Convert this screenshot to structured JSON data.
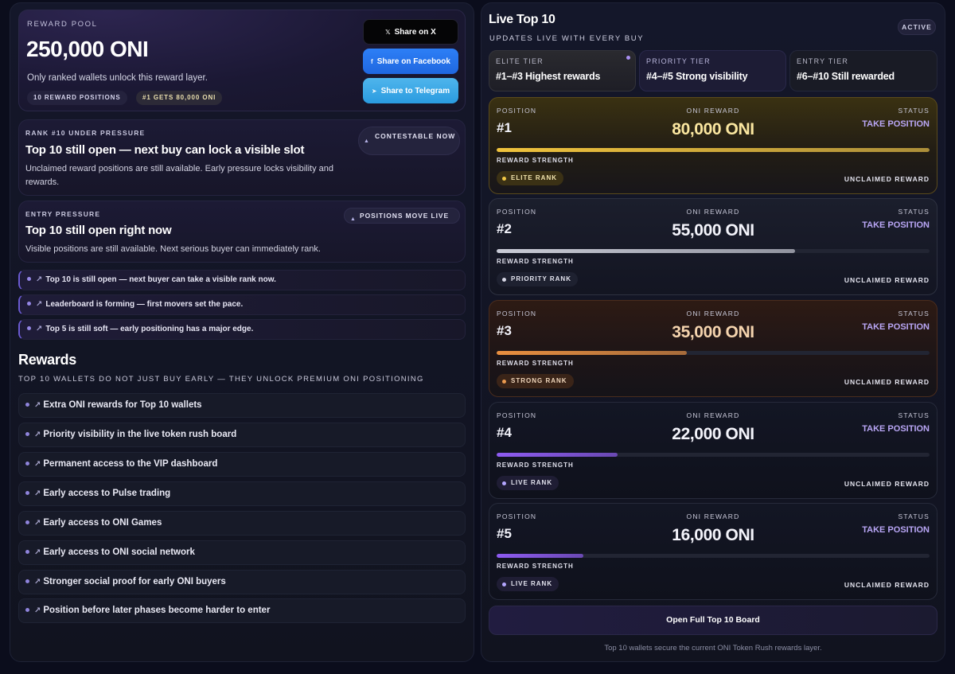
{
  "reward_pool": {
    "kicker": "REWARD POOL",
    "amount": "250,000 ONI",
    "note": "Only ranked wallets unlock this reward layer.",
    "pills": [
      "10 REWARD POSITIONS",
      "#1 GETS 80,000 ONI"
    ]
  },
  "share": {
    "x_label": "Share on X",
    "x_icon": "𝕏",
    "facebook_label": "Share on Facebook",
    "facebook_icon": "f",
    "telegram_label": "Share to Telegram",
    "telegram_icon": "➤"
  },
  "rank_pressure": {
    "kicker": "RANK #10 UNDER PRESSURE",
    "title": "Top 10 still open — next buy can lock a visible slot",
    "body": "Unclaimed reward positions are still available. Early pressure locks visibility and rewards.",
    "badge": "CONTESTABLE NOW"
  },
  "entry_pressure": {
    "kicker": "ENTRY PRESSURE",
    "title": "Top 10 still open right now",
    "body": "Visible positions are still available. Next serious buyer can immediately rank.",
    "badge": "POSITIONS MOVE LIVE"
  },
  "tickers": [
    "Top 10 is still open — next buyer can take a visible rank now.",
    "Leaderboard is forming — first movers set the pace.",
    "Top 5 is still soft — early positioning has a major edge."
  ],
  "rewards": {
    "title": "Rewards",
    "subtitle": "TOP 10 WALLETS DO NOT JUST BUY EARLY — THEY UNLOCK PREMIUM ONI POSITIONING",
    "items": [
      "Extra ONI rewards for Top 10 wallets",
      "Priority visibility in the live token rush board",
      "Permanent access to the VIP dashboard",
      "Early access to Pulse trading",
      "Early access to ONI Games",
      "Early access to ONI social network",
      "Stronger social proof for early ONI buyers",
      "Position before later phases become harder to enter"
    ]
  },
  "live": {
    "title": "Live Top 10",
    "subtitle": "UPDATES LIVE WITH EVERY BUY",
    "status": "ACTIVE"
  },
  "tiers": [
    {
      "kicker": "ELITE TIER",
      "value": "#1–#3 Highest rewards"
    },
    {
      "kicker": "PRIORITY TIER",
      "value": "#4–#5 Strong visibility"
    },
    {
      "kicker": "ENTRY TIER",
      "value": "#6–#10 Still rewarded"
    }
  ],
  "labels": {
    "position": "POSITION",
    "oni_reward": "ONI REWARD",
    "status": "STATUS",
    "take": "TAKE POSITION",
    "strength": "REWARD STRENGTH",
    "unclaimed": "UNCLAIMED REWARD"
  },
  "positions": [
    {
      "rank": "#1",
      "reward": "80,000 ONI",
      "chip": "ELITE RANK",
      "strength": 1.0,
      "fill": "#f0c33c"
    },
    {
      "rank": "#2",
      "reward": "55,000 ONI",
      "chip": "PRIORITY RANK",
      "strength": 0.69,
      "fill": "#c9cbd6"
    },
    {
      "rank": "#3",
      "reward": "35,000 ONI",
      "chip": "STRONG RANK",
      "strength": 0.44,
      "fill": "#e98f3f"
    },
    {
      "rank": "#4",
      "reward": "22,000 ONI",
      "chip": "LIVE RANK",
      "strength": 0.28,
      "fill": "#8e5bf2"
    },
    {
      "rank": "#5",
      "reward": "16,000 ONI",
      "chip": "LIVE RANK",
      "strength": 0.2,
      "fill": "#8e5bf2"
    }
  ],
  "open_board": "Open Full Top 10 Board",
  "footnote": "Top 10 wallets secure the current ONI Token Rush rewards layer."
}
